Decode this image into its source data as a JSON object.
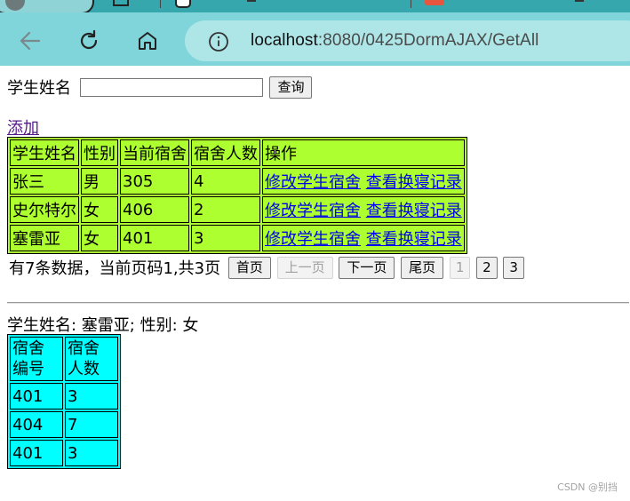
{
  "browser": {
    "url_host": "localhost",
    "url_path": ":8080/0425DormAJAX/GetAll"
  },
  "search": {
    "label": "学生姓名",
    "value": "",
    "placeholder": "",
    "button": "查询"
  },
  "add_link": "添加",
  "students_table": {
    "headers": [
      "学生姓名",
      "性别",
      "当前宿舍",
      "宿舍人数",
      "操作"
    ],
    "rows": [
      {
        "name": "张三",
        "gender": "男",
        "dorm": "305",
        "count": "4"
      },
      {
        "name": "史尔特尔",
        "gender": "女",
        "dorm": "406",
        "count": "2"
      },
      {
        "name": "塞雷亚",
        "gender": "女",
        "dorm": "401",
        "count": "3"
      }
    ],
    "action_edit": "修改学生宿舍",
    "action_history": "查看换寝记录"
  },
  "pager": {
    "info": "有7条数据，当前页码1,共3页",
    "first": "首页",
    "prev": "上一页",
    "next": "下一页",
    "last": "尾页",
    "pages": [
      "1",
      "2",
      "3"
    ],
    "current_page": "1"
  },
  "detail": {
    "text": "学生姓名: 塞雷亚; 性别: 女"
  },
  "dorm_table": {
    "headers": [
      "宿舍编号",
      "宿舍人数"
    ],
    "header_lines": [
      [
        "宿舍",
        "编号"
      ],
      [
        "宿舍",
        "人数"
      ]
    ],
    "rows": [
      {
        "dorm": "401",
        "count": "3"
      },
      {
        "dorm": "404",
        "count": "7"
      },
      {
        "dorm": "401",
        "count": "3"
      }
    ]
  },
  "watermark": "CSDN @别挡",
  "colors": {
    "students_table_bg": "#adff2f",
    "dorm_table_bg": "#00ffff",
    "toolbar_bg": "#7fd5d9",
    "tabstrip_bg": "#35a7ad",
    "link": "#0000ee"
  }
}
